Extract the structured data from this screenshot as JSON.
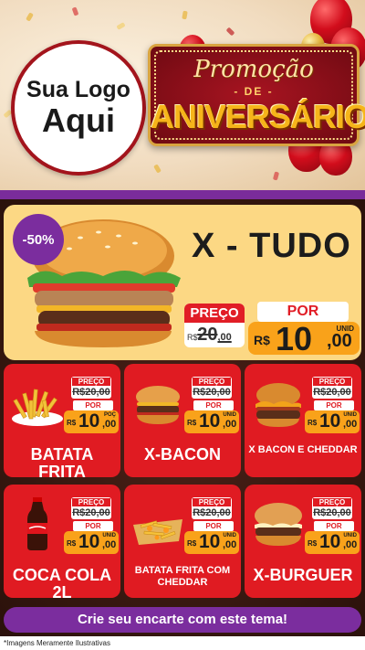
{
  "header": {
    "logo_line1": "Sua Logo",
    "logo_line2": "Aqui",
    "promo_title": "Promoção",
    "promo_de": "- DE -",
    "promo_main": "ANIVERSÁRIO"
  },
  "featured": {
    "badge": "-50%",
    "name": "X - TUDO",
    "preco_label": "PREÇO",
    "old_currency": "R$",
    "old_int": "20",
    "old_dec": ",00",
    "por_label": "POR",
    "new_currency": "R$",
    "new_int": "10",
    "new_dec": ",00",
    "unit": "UNID"
  },
  "products": [
    {
      "name": "BATATA FRITA",
      "preco_label": "PREÇO",
      "old_price": "R$20,00",
      "por_label": "POR",
      "currency": "R$",
      "int": "10",
      "dec": ",00",
      "unit": "POÇ"
    },
    {
      "name": "X-BACON",
      "preco_label": "PREÇO",
      "old_price": "R$20,00",
      "por_label": "POR",
      "currency": "R$",
      "int": "10",
      "dec": ",00",
      "unit": "UNID"
    },
    {
      "name": "X BACON E CHEDDAR",
      "preco_label": "PREÇO",
      "old_price": "R$20,00",
      "por_label": "POR",
      "currency": "R$",
      "int": "10",
      "dec": ",00",
      "unit": "UNID"
    },
    {
      "name": "COCA COLA 2L",
      "preco_label": "PREÇO",
      "old_price": "R$20,00",
      "por_label": "POR",
      "currency": "R$",
      "int": "10",
      "dec": ",00",
      "unit": "UNID"
    },
    {
      "name": "BATATA FRITA COM CHEDDAR",
      "preco_label": "PREÇO",
      "old_price": "R$20,00",
      "por_label": "POR",
      "currency": "R$",
      "int": "10",
      "dec": ",00",
      "unit": "UNID"
    },
    {
      "name": "X-BURGUER",
      "preco_label": "PREÇO",
      "old_price": "R$20,00",
      "por_label": "POR",
      "currency": "R$",
      "int": "10",
      "dec": ",00",
      "unit": "UNID"
    }
  ],
  "cta": "Crie seu encarte com este tema!",
  "disclaimer": "*Imagens Meramente Ilustrativas",
  "colors": {
    "purple": "#7b2d9e",
    "red": "#e01b22",
    "orange": "#f9a21a",
    "featured_bg": "#fcd884"
  },
  "icons": [
    "burger-image",
    "fries-image",
    "soda-bottle-image",
    "balloons-decoration"
  ]
}
